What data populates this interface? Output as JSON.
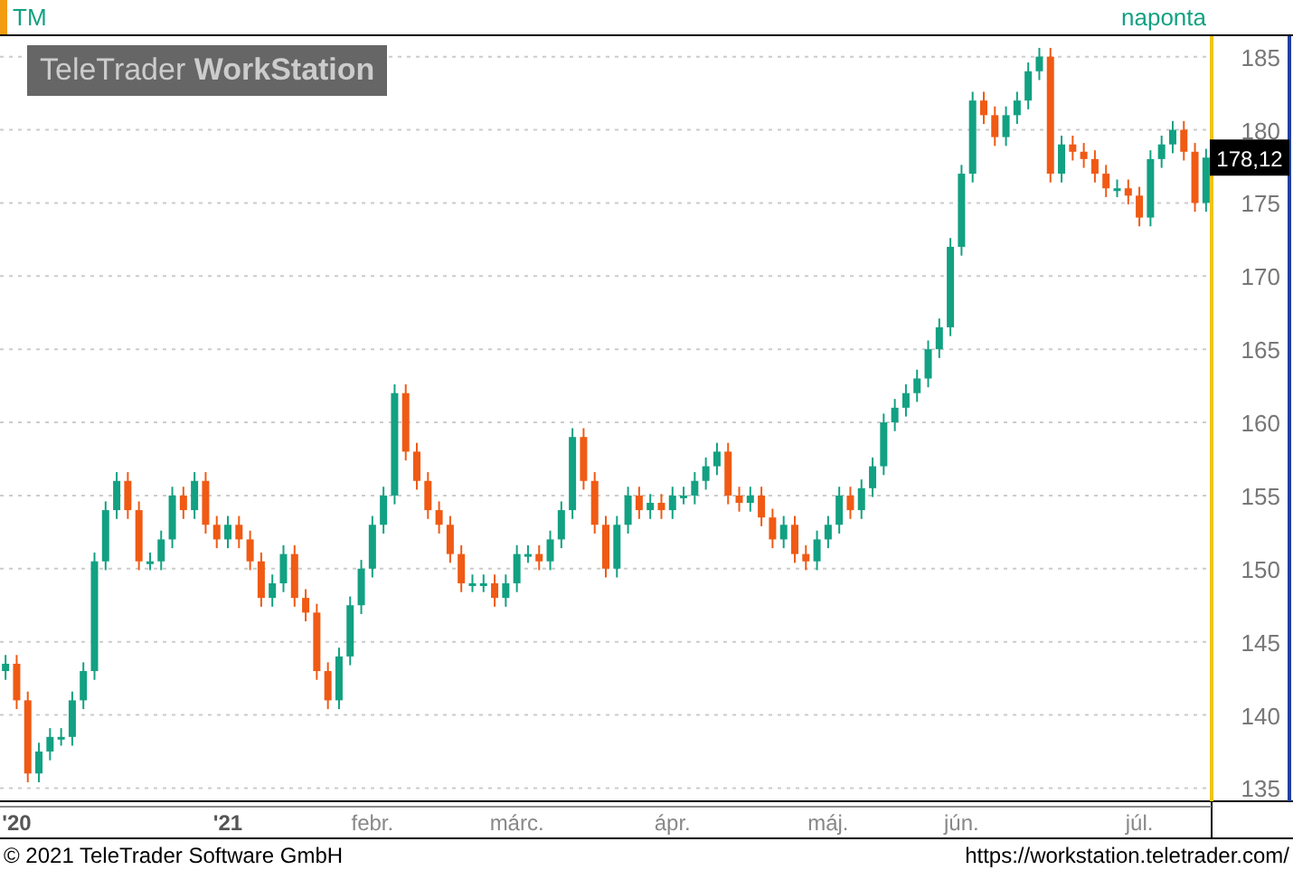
{
  "header": {
    "symbol": "TM",
    "interval": "naponta"
  },
  "logo": {
    "brand": "TeleTrader",
    "product": "WorkStation"
  },
  "chart": {
    "last_price": "178,12",
    "chart_data": {
      "type": "candlestick",
      "grid": true,
      "ylim": [
        134.1,
        186.4
      ],
      "yticks": [
        135,
        140,
        145,
        150,
        155,
        160,
        165,
        170,
        175,
        180,
        185
      ],
      "categories": [
        null,
        "'20",
        null,
        null,
        null,
        null,
        null,
        null,
        null,
        null,
        null,
        null,
        null,
        null,
        null,
        null,
        null,
        null,
        null,
        null,
        "'21",
        null,
        null,
        null,
        null,
        null,
        null,
        null,
        null,
        null,
        null,
        null,
        null,
        "febr.",
        null,
        null,
        null,
        null,
        null,
        null,
        null,
        null,
        null,
        null,
        null,
        null,
        "márc.",
        null,
        null,
        null,
        null,
        null,
        null,
        null,
        null,
        null,
        null,
        null,
        null,
        null,
        "ápr.",
        null,
        null,
        null,
        null,
        null,
        null,
        null,
        null,
        null,
        null,
        null,
        null,
        null,
        "máj.",
        null,
        null,
        null,
        null,
        null,
        null,
        null,
        null,
        null,
        null,
        null,
        "jún.",
        null,
        null,
        null,
        null,
        null,
        null,
        null,
        null,
        null,
        null,
        null,
        null,
        null,
        null,
        null,
        "júl.",
        null,
        null,
        null,
        null,
        null,
        null
      ],
      "ohlc": [
        [
          143,
          144.1,
          142.4,
          143.5
        ],
        [
          143.5,
          144.1,
          140.4,
          141
        ],
        [
          141,
          141.6,
          135.4,
          136
        ],
        [
          136,
          138.1,
          135.4,
          137.5
        ],
        [
          137.5,
          139.1,
          136.9,
          138.5
        ],
        [
          138.5,
          139.1,
          137.9,
          138.5
        ],
        [
          138.5,
          141.6,
          137.9,
          141
        ],
        [
          141,
          143.6,
          140.4,
          143
        ],
        [
          143,
          151.1,
          142.4,
          150.5
        ],
        [
          150.5,
          154.6,
          149.9,
          154
        ],
        [
          154,
          156.6,
          153.4,
          156
        ],
        [
          156,
          156.6,
          153.4,
          154
        ],
        [
          154,
          154.6,
          149.9,
          150.5
        ],
        [
          150.5,
          151.1,
          149.9,
          150.5
        ],
        [
          150.5,
          152.6,
          149.9,
          152
        ],
        [
          152,
          155.6,
          151.4,
          155
        ],
        [
          155,
          155.6,
          153.4,
          154
        ],
        [
          154,
          156.6,
          153.4,
          156
        ],
        [
          156,
          156.6,
          152.4,
          153
        ],
        [
          153,
          153.6,
          151.4,
          152
        ],
        [
          152,
          153.6,
          151.4,
          153
        ],
        [
          153,
          153.6,
          151.4,
          152
        ],
        [
          152,
          152.6,
          149.9,
          150.5
        ],
        [
          150.5,
          151.1,
          147.4,
          148
        ],
        [
          148,
          149.6,
          147.4,
          149
        ],
        [
          149,
          151.6,
          148.4,
          151
        ],
        [
          151,
          151.6,
          147.4,
          148
        ],
        [
          148,
          148.6,
          146.4,
          147
        ],
        [
          147,
          147.6,
          142.4,
          143
        ],
        [
          143,
          143.6,
          140.4,
          141
        ],
        [
          141,
          144.6,
          140.4,
          144
        ],
        [
          144,
          148.1,
          143.4,
          147.5
        ],
        [
          147.5,
          150.6,
          146.9,
          150
        ],
        [
          150,
          153.6,
          149.4,
          153
        ],
        [
          153,
          155.6,
          152.4,
          155
        ],
        [
          155,
          162.6,
          154.4,
          162
        ],
        [
          162,
          162.6,
          157.4,
          158
        ],
        [
          158,
          158.6,
          155.4,
          156
        ],
        [
          156,
          156.6,
          153.4,
          154
        ],
        [
          154,
          154.6,
          152.4,
          153
        ],
        [
          153,
          153.6,
          150.4,
          151
        ],
        [
          151,
          151.6,
          148.4,
          149
        ],
        [
          149,
          149.6,
          148.4,
          149
        ],
        [
          149,
          149.6,
          148.4,
          149
        ],
        [
          149,
          149.6,
          147.4,
          148
        ],
        [
          148,
          149.6,
          147.4,
          149
        ],
        [
          149,
          151.6,
          148.4,
          151
        ],
        [
          151,
          151.6,
          150.4,
          151
        ],
        [
          151,
          151.6,
          149.9,
          150.5
        ],
        [
          150.5,
          152.6,
          149.9,
          152
        ],
        [
          152,
          154.6,
          151.4,
          154
        ],
        [
          154,
          159.6,
          153.4,
          159
        ],
        [
          159,
          159.6,
          155.4,
          156
        ],
        [
          156,
          156.6,
          152.4,
          153
        ],
        [
          153,
          153.6,
          149.4,
          150
        ],
        [
          150,
          153.6,
          149.4,
          153
        ],
        [
          153,
          155.6,
          152.4,
          155
        ],
        [
          155,
          155.6,
          153.4,
          154
        ],
        [
          154,
          155.1,
          153.4,
          154.5
        ],
        [
          154.5,
          155.1,
          153.4,
          154
        ],
        [
          154,
          155.6,
          153.4,
          155
        ],
        [
          155,
          155.6,
          154.4,
          155
        ],
        [
          155,
          156.6,
          154.4,
          156
        ],
        [
          156,
          157.6,
          155.4,
          157
        ],
        [
          157,
          158.6,
          156.4,
          158
        ],
        [
          158,
          158.6,
          154.4,
          155
        ],
        [
          155,
          155.6,
          153.9,
          154.5
        ],
        [
          154.5,
          155.6,
          153.9,
          155
        ],
        [
          155,
          155.6,
          152.9,
          153.5
        ],
        [
          153.5,
          154.1,
          151.4,
          152
        ],
        [
          152,
          153.6,
          151.4,
          153
        ],
        [
          153,
          153.6,
          150.4,
          151
        ],
        [
          151,
          151.6,
          149.9,
          150.5
        ],
        [
          150.5,
          152.6,
          149.9,
          152
        ],
        [
          152,
          153.6,
          151.4,
          153
        ],
        [
          153,
          155.6,
          152.4,
          155
        ],
        [
          155,
          155.6,
          153.4,
          154
        ],
        [
          154,
          156.1,
          153.4,
          155.5
        ],
        [
          155.5,
          157.6,
          154.9,
          157
        ],
        [
          157,
          160.6,
          156.4,
          160
        ],
        [
          160,
          161.6,
          159.4,
          161
        ],
        [
          161,
          162.6,
          160.4,
          162
        ],
        [
          162,
          163.6,
          161.4,
          163
        ],
        [
          163,
          165.6,
          162.4,
          165
        ],
        [
          165,
          167.1,
          164.4,
          166.5
        ],
        [
          166.5,
          172.6,
          165.9,
          172
        ],
        [
          172,
          177.6,
          171.4,
          177
        ],
        [
          177,
          182.6,
          176.4,
          182
        ],
        [
          182,
          182.6,
          180.4,
          181
        ],
        [
          181,
          181.6,
          178.9,
          179.5
        ],
        [
          179.5,
          181.6,
          178.9,
          181
        ],
        [
          181,
          182.6,
          180.4,
          182
        ],
        [
          182,
          184.6,
          181.4,
          184
        ],
        [
          184,
          185.6,
          183.4,
          185
        ],
        [
          185,
          185.6,
          176.4,
          177
        ],
        [
          177,
          179.6,
          176.4,
          179
        ],
        [
          179,
          179.6,
          177.9,
          178.5
        ],
        [
          178.5,
          179.1,
          177.4,
          178
        ],
        [
          178,
          178.6,
          176.4,
          177
        ],
        [
          177,
          177.6,
          175.4,
          176
        ],
        [
          176,
          176.6,
          175.4,
          176
        ],
        [
          176,
          176.6,
          174.9,
          175.5
        ],
        [
          175.5,
          176.1,
          173.4,
          174
        ],
        [
          174,
          178.6,
          173.4,
          178
        ],
        [
          178,
          179.6,
          177.4,
          179
        ],
        [
          179,
          180.6,
          178.4,
          180
        ],
        [
          180,
          180.6,
          177.9,
          178.5
        ],
        [
          178.5,
          179.1,
          174.4,
          175
        ],
        [
          175,
          178.7,
          174.4,
          178.1
        ]
      ]
    }
  },
  "footer": {
    "copyright": "© 2021 TeleTrader Software GmbH",
    "url": "https://workstation.teletrader.com/"
  }
}
